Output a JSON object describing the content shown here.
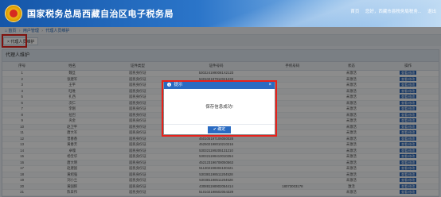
{
  "header": {
    "title": "国家税务总局西藏自治区电子税务局",
    "user_links": [
      "首页",
      "您好，西藏市县税务局税务...",
      "退出"
    ]
  },
  "breadcrumb": [
    "首页",
    "用户管理",
    "代理人员维护"
  ],
  "tab": {
    "label": "代理人员维护"
  },
  "panel": {
    "title": "代理人维护"
  },
  "table": {
    "headers": [
      "序号",
      "姓名",
      "证件类型",
      "证件号码",
      "手机号码",
      "状态",
      "操作"
    ],
    "rows": [
      [
        "1",
        "魏旦",
        "居民身份证",
        "5302241990081X2123",
        "",
        "未激活",
        "查看/修改"
      ],
      [
        "2",
        "张建军",
        "居民身份证",
        "540102197912041233",
        "",
        "未激活",
        "查看/修改"
      ],
      [
        "3",
        "王平",
        "居民身份证",
        "533022198101051524",
        "",
        "未激活",
        "查看/修改"
      ],
      [
        "4",
        "旺堆",
        "居民身份证",
        "542123197603261030",
        "",
        "未激活",
        "查看/修改"
      ],
      [
        "5",
        "扎西",
        "居民身份证",
        "542127198305120512",
        "",
        "未激活",
        "查看/修改"
      ],
      [
        "6",
        "次仁",
        "居民身份证",
        "540102197808150218",
        "",
        "未激活",
        "查看/修改"
      ],
      [
        "7",
        "李刚",
        "居民身份证",
        "510105198001017536",
        "",
        "未激活",
        "查看/修改"
      ],
      [
        "8",
        "拉巴",
        "居民身份证",
        "542226197511030515",
        "",
        "未激活",
        "查看/修改"
      ],
      [
        "9",
        "央金",
        "居民身份证",
        "540121199002080224",
        "",
        "未激活",
        "查看/修改"
      ],
      [
        "10",
        "赵卫平",
        "居民身份证",
        "510107197712281416",
        "",
        "未激活",
        "查看/修改"
      ],
      [
        "11",
        "唐大军",
        "居民身份证",
        "430102197510175633",
        "",
        "未激活",
        "查看/修改"
      ],
      [
        "12",
        "曾春香",
        "居民身份证",
        "450105197106050028",
        "",
        "未激活",
        "查看/修改"
      ],
      [
        "13",
        "黄春芳",
        "居民身份证",
        "452502198010210216",
        "",
        "未激活",
        "查看/修改"
      ],
      [
        "14",
        "卓嘎",
        "居民身份证",
        "530321199205131210",
        "",
        "未激活",
        "查看/修改"
      ],
      [
        "15",
        "杨宝华",
        "居民身份证",
        "530321198410010254",
        "",
        "未激活",
        "查看/修改"
      ],
      [
        "16",
        "唐大明",
        "居民身份证",
        "452123196708050563",
        "",
        "未激活",
        "查看/修改"
      ],
      [
        "17",
        "赵建国",
        "居民身份证",
        "511302198304100421",
        "",
        "未激活",
        "查看/修改"
      ],
      [
        "18",
        "黄绍强",
        "居民身份证",
        "530381198511204528",
        "",
        "未激活",
        "查看/修改"
      ],
      [
        "19",
        "刘小兰",
        "居民身份证",
        "530381198511204528",
        "",
        "未激活",
        "查看/修改"
      ],
      [
        "20",
        "黄国辉",
        "居民身份证",
        "430881198902054414",
        "18073003178",
        "激活",
        "查看/修改"
      ],
      [
        "21",
        "陈日伟",
        "居民身份证",
        "510102198602054329",
        "",
        "未激活",
        "查看/修改"
      ]
    ]
  },
  "dialog": {
    "title": "提示",
    "message": "保存信息成功!",
    "close": "×",
    "confirm": "✔ 确定"
  }
}
